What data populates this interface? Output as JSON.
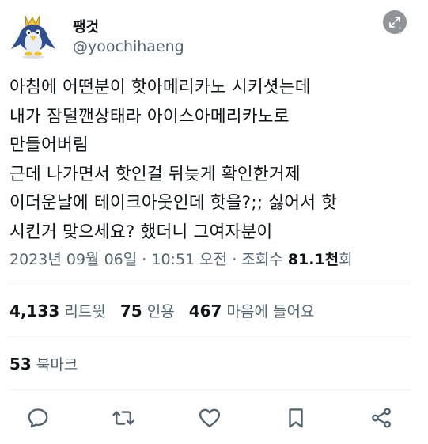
{
  "user": {
    "display_name": "팽것",
    "handle": "@yoochihaeng"
  },
  "tweet": {
    "text": "아침에 어떤분이 핫아메리카노 시키셧는데\n내가 잠덜깬상태라 아이스아메리카노로\n만들어버림\n근데 나가면서 핫인걸 뒤늦게 확인한거제\n이더운날에 테이크아웃인데 핫을?;; 싫어서 핫\n시킨거 맞으세요? 했더니 그여자분이"
  },
  "meta": {
    "date": "2023년 09월 06일",
    "time": "10:51 오전",
    "views_label": "조회수",
    "views_count": "81.1천",
    "views_suffix": "회",
    "separator": "·"
  },
  "stats": {
    "retweets_count": "4,133",
    "retweets_label": "리트윗",
    "quotes_count": "75",
    "quotes_label": "인용",
    "likes_count": "467",
    "likes_label": "마음에 들어요"
  },
  "bookmarks": {
    "count": "53",
    "label": "북마크"
  },
  "icons": {
    "expand": "expand-arrows-icon",
    "reply": "reply-icon",
    "retweet": "retweet-icon",
    "like": "heart-icon",
    "bookmark": "bookmark-icon",
    "share": "share-icon"
  },
  "colors": {
    "text": "#0f1419",
    "secondary": "#536471",
    "divider": "#eff3f4",
    "icon": "#536471"
  }
}
